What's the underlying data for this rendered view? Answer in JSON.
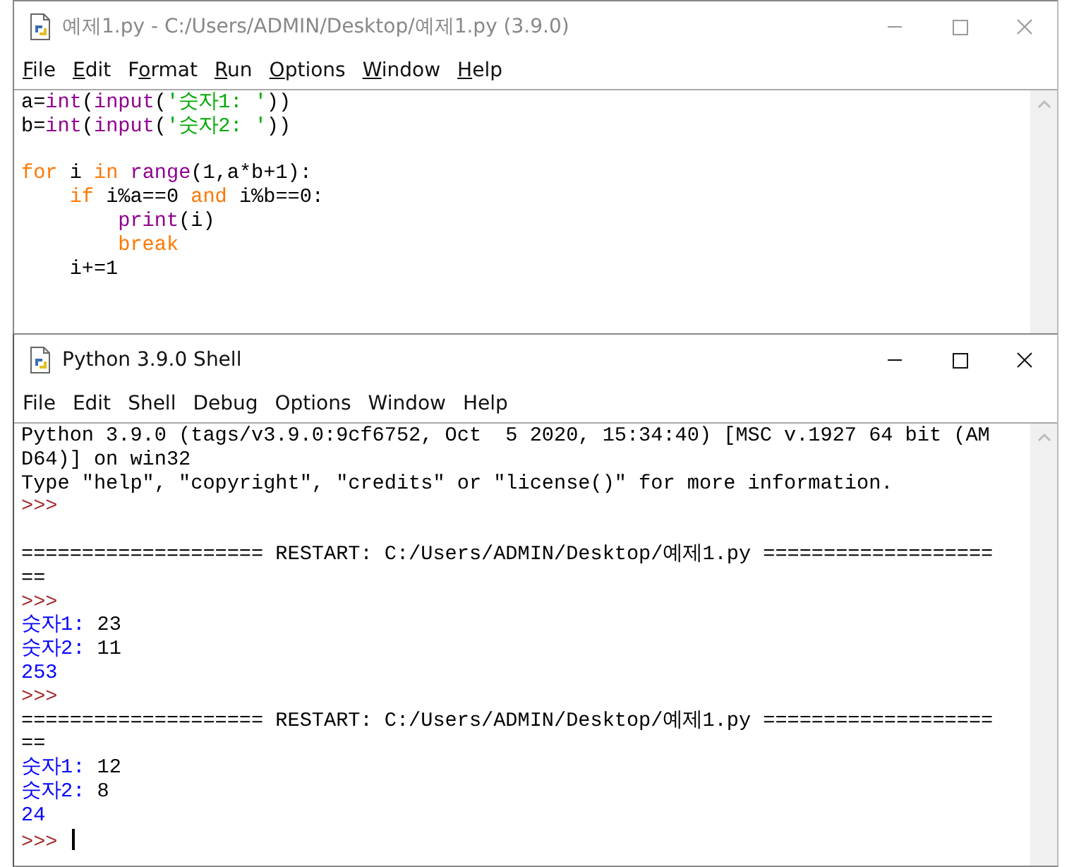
{
  "windows": [
    {
      "kind": "editor",
      "active": false,
      "title": "예제1.py - C:/Users/ADMIN/Desktop/예제1.py (3.9.0)",
      "menu": [
        {
          "parts": [
            {
              "text": "F",
              "underlined": true
            },
            {
              "text": "ile",
              "underlined": false
            }
          ]
        },
        {
          "parts": [
            {
              "text": "E",
              "underlined": true
            },
            {
              "text": "dit",
              "underlined": false
            }
          ]
        },
        {
          "parts": [
            {
              "text": "F",
              "underlined": false
            },
            {
              "text": "o",
              "underlined": true
            },
            {
              "text": "rmat",
              "underlined": false
            }
          ]
        },
        {
          "parts": [
            {
              "text": "R",
              "underlined": true
            },
            {
              "text": "un",
              "underlined": false
            }
          ]
        },
        {
          "parts": [
            {
              "text": "O",
              "underlined": true
            },
            {
              "text": "ptions",
              "underlined": false
            }
          ]
        },
        {
          "parts": [
            {
              "text": "W",
              "underlined": true
            },
            {
              "text": "indow",
              "underlined": false
            }
          ]
        },
        {
          "parts": [
            {
              "text": "H",
              "underlined": true
            },
            {
              "text": "elp",
              "underlined": false
            }
          ]
        }
      ],
      "lines": [
        {
          "kind": "text",
          "tokens": [
            {
              "text": "a=",
              "kind": "plain"
            },
            {
              "text": "int",
              "kind": "builtin"
            },
            {
              "text": "(",
              "kind": "plain"
            },
            {
              "text": "input",
              "kind": "builtin"
            },
            {
              "text": "(",
              "kind": "plain"
            },
            {
              "text": "'숫자1: '",
              "kind": "string"
            },
            {
              "text": "))",
              "kind": "plain"
            }
          ]
        },
        {
          "kind": "text",
          "tokens": [
            {
              "text": "b=",
              "kind": "plain"
            },
            {
              "text": "int",
              "kind": "builtin"
            },
            {
              "text": "(",
              "kind": "plain"
            },
            {
              "text": "input",
              "kind": "builtin"
            },
            {
              "text": "(",
              "kind": "plain"
            },
            {
              "text": "'숫자2: '",
              "kind": "string"
            },
            {
              "text": "))",
              "kind": "plain"
            }
          ]
        },
        {
          "kind": "blank"
        },
        {
          "kind": "text",
          "tokens": [
            {
              "text": "for",
              "kind": "keyword"
            },
            {
              "text": " i ",
              "kind": "plain"
            },
            {
              "text": "in",
              "kind": "keyword"
            },
            {
              "text": " range",
              "kind": "builtin"
            },
            {
              "text": "(1,a*b+1):",
              "kind": "plain"
            }
          ]
        },
        {
          "kind": "text",
          "tokens": [
            {
              "text": "    if",
              "kind": "keyword"
            },
            {
              "text": " i%a==0 ",
              "kind": "plain"
            },
            {
              "text": "and",
              "kind": "keyword"
            },
            {
              "text": " i%b==0:",
              "kind": "plain"
            }
          ]
        },
        {
          "kind": "text",
          "tokens": [
            {
              "text": "        print",
              "kind": "builtin"
            },
            {
              "text": "(i)",
              "kind": "plain"
            }
          ]
        },
        {
          "kind": "text",
          "tokens": [
            {
              "text": "        break",
              "kind": "keyword"
            }
          ]
        },
        {
          "kind": "text",
          "tokens": [
            {
              "text": "    i+=1",
              "kind": "plain"
            }
          ]
        }
      ]
    },
    {
      "kind": "shell",
      "active": true,
      "title": "Python 3.9.0 Shell",
      "menu": [
        {
          "parts": [
            {
              "text": "File",
              "underlined": false
            }
          ]
        },
        {
          "parts": [
            {
              "text": "Edit",
              "underlined": false
            }
          ]
        },
        {
          "parts": [
            {
              "text": "Shell",
              "underlined": false
            }
          ]
        },
        {
          "parts": [
            {
              "text": "Debug",
              "underlined": false
            }
          ]
        },
        {
          "parts": [
            {
              "text": "Options",
              "underlined": false
            }
          ]
        },
        {
          "parts": [
            {
              "text": "Window",
              "underlined": false
            }
          ]
        },
        {
          "parts": [
            {
              "text": "Help",
              "underlined": false
            }
          ]
        }
      ],
      "lines": [
        {
          "kind": "text",
          "tokens": [
            {
              "text": "Python 3.9.0 (tags/v3.9.0:9cf6752, Oct  5 2020, 15:34:40) [MSC v.1927 64 bit (AM",
              "kind": "plain"
            }
          ]
        },
        {
          "kind": "text",
          "tokens": [
            {
              "text": "D64)] on win32",
              "kind": "plain"
            }
          ]
        },
        {
          "kind": "text",
          "tokens": [
            {
              "text": "Type \"help\", \"copyright\", \"credits\" or \"license()\" for more information.",
              "kind": "plain"
            }
          ]
        },
        {
          "kind": "text",
          "tokens": [
            {
              "text": ">>>",
              "kind": "prompt"
            }
          ]
        },
        {
          "kind": "blank"
        },
        {
          "kind": "text",
          "tokens": [
            {
              "text": "==================== RESTART: C:/Users/ADMIN/Desktop/예제1.py ===================",
              "kind": "plain"
            }
          ]
        },
        {
          "kind": "text",
          "tokens": [
            {
              "text": "==",
              "kind": "plain"
            }
          ]
        },
        {
          "kind": "text",
          "tokens": [
            {
              "text": ">>>",
              "kind": "prompt"
            }
          ]
        },
        {
          "kind": "text",
          "tokens": [
            {
              "text": "숫자1: ",
              "kind": "stdout"
            },
            {
              "text": "23",
              "kind": "plain"
            }
          ]
        },
        {
          "kind": "text",
          "tokens": [
            {
              "text": "숫자2: ",
              "kind": "stdout"
            },
            {
              "text": "11",
              "kind": "plain"
            }
          ]
        },
        {
          "kind": "text",
          "tokens": [
            {
              "text": "253",
              "kind": "stdout"
            }
          ]
        },
        {
          "kind": "text",
          "tokens": [
            {
              "text": ">>>",
              "kind": "prompt"
            }
          ]
        },
        {
          "kind": "text",
          "tokens": [
            {
              "text": "==================== RESTART: C:/Users/ADMIN/Desktop/예제1.py ===================",
              "kind": "plain"
            }
          ]
        },
        {
          "kind": "text",
          "tokens": [
            {
              "text": "==",
              "kind": "plain"
            }
          ]
        },
        {
          "kind": "text",
          "tokens": [
            {
              "text": "숫자1: ",
              "kind": "stdout"
            },
            {
              "text": "12",
              "kind": "plain"
            }
          ]
        },
        {
          "kind": "text",
          "tokens": [
            {
              "text": "숫자2: ",
              "kind": "stdout"
            },
            {
              "text": "8",
              "kind": "plain"
            }
          ]
        },
        {
          "kind": "text",
          "tokens": [
            {
              "text": "24",
              "kind": "stdout"
            }
          ]
        },
        {
          "kind": "text",
          "cursor": true,
          "tokens": [
            {
              "text": ">>> ",
              "kind": "prompt"
            }
          ]
        }
      ]
    }
  ]
}
